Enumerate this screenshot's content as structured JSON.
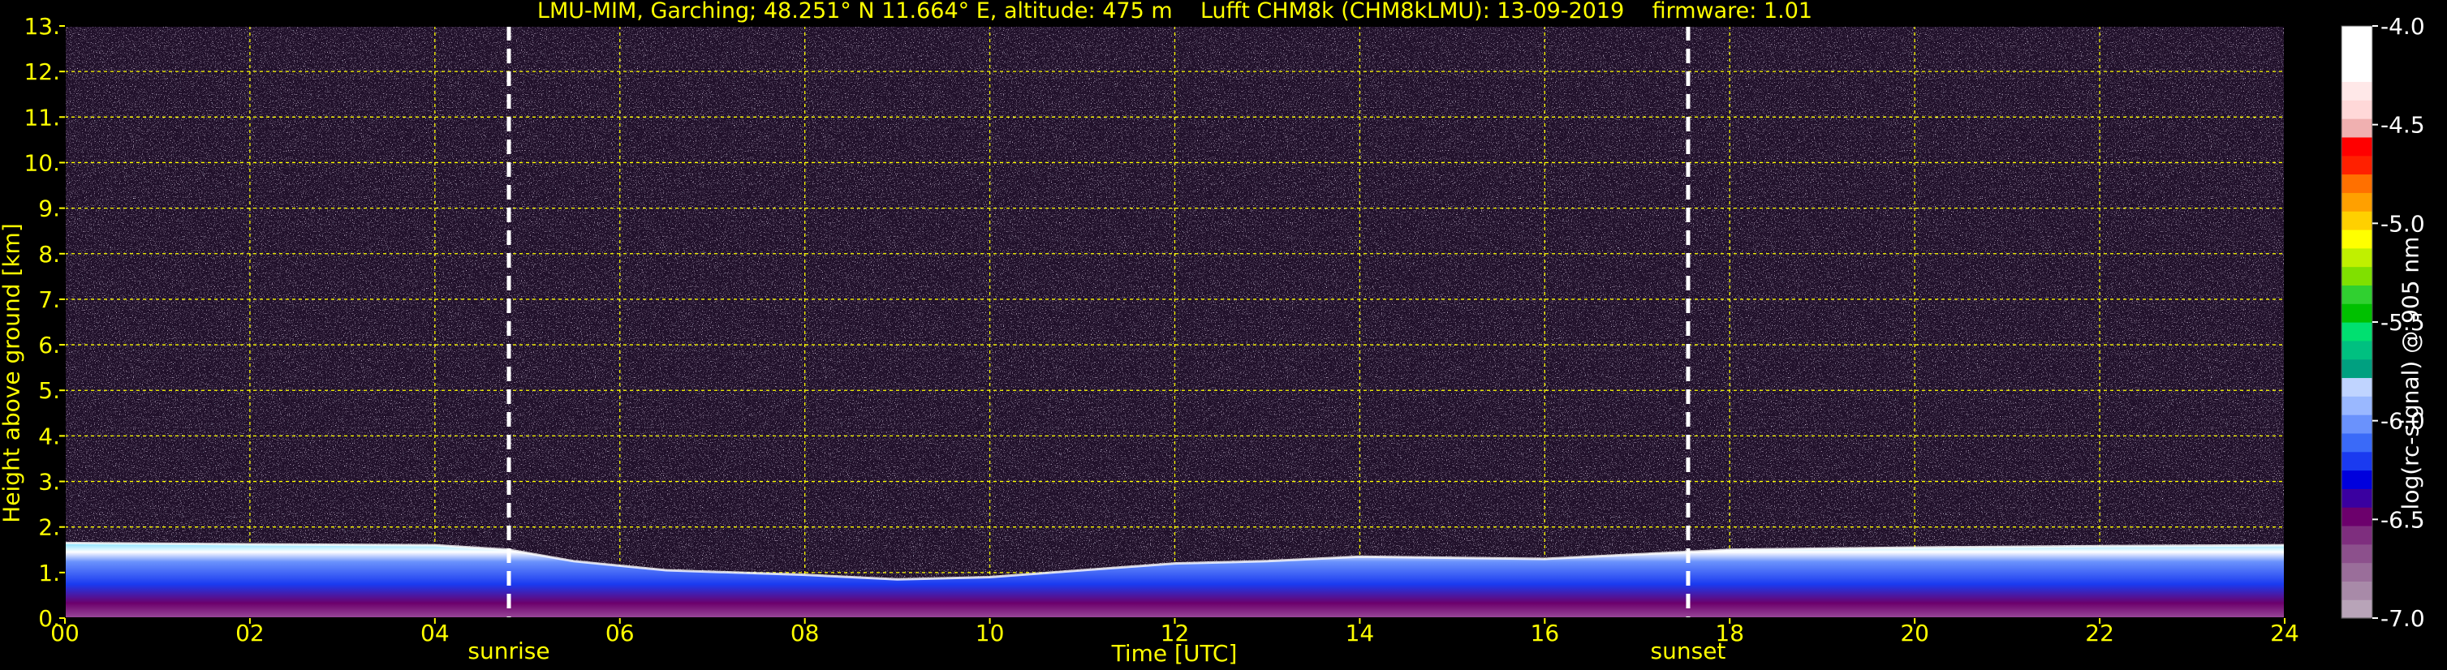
{
  "title": "LMU-MIM, Garching; 48.251° N 11.664° E, altitude: 475 m    Lufft CHM8k (CHM8kLMU): 13-09-2019    firmware: 1.01",
  "colors": {
    "axis_text": "#ffff00",
    "grid": "#ffff00",
    "background": "#000000",
    "cbar_text": "#ffffff"
  },
  "chart_data": {
    "type": "heatmap",
    "title": "LMU-MIM, Garching; 48.251° N 11.664° E, altitude: 475 m    Lufft CHM8k (CHM8kLMU): 13-09-2019    firmware: 1.01",
    "xlabel": "Time [UTC]",
    "ylabel": "Height above ground [km]",
    "xlim": [
      0,
      24
    ],
    "ylim": [
      0,
      13
    ],
    "xticks": [
      0,
      2,
      4,
      6,
      8,
      10,
      12,
      14,
      16,
      18,
      20,
      22,
      24
    ],
    "xtick_labels": [
      "00",
      "02",
      "04",
      "06",
      "08",
      "10",
      "12",
      "14",
      "16",
      "18",
      "20",
      "22",
      "24"
    ],
    "yticks": [
      0,
      1,
      2,
      3,
      4,
      5,
      6,
      7,
      8,
      9,
      10,
      11,
      12,
      13
    ],
    "ytick_labels": [
      "0.",
      "1.",
      "2.",
      "3.",
      "4.",
      "5.",
      "6.",
      "7.",
      "8.",
      "9.",
      "10.",
      "11.",
      "12.",
      "13."
    ],
    "grid": true,
    "annotations": [
      {
        "label": "sunrise",
        "x": 4.8
      },
      {
        "label": "sunset",
        "x": 17.55
      }
    ],
    "boundary_layer_top_km": [
      [
        0,
        1.65
      ],
      [
        2,
        1.62
      ],
      [
        4,
        1.6
      ],
      [
        4.8,
        1.5
      ],
      [
        5.5,
        1.25
      ],
      [
        6.5,
        1.05
      ],
      [
        8,
        0.95
      ],
      [
        9,
        0.85
      ],
      [
        10,
        0.9
      ],
      [
        11,
        1.05
      ],
      [
        12,
        1.2
      ],
      [
        13,
        1.25
      ],
      [
        14,
        1.35
      ],
      [
        16,
        1.3
      ],
      [
        17.5,
        1.45
      ],
      [
        18,
        1.5
      ],
      [
        20,
        1.55
      ],
      [
        22,
        1.58
      ],
      [
        24,
        1.6
      ]
    ],
    "colorbar": {
      "label": "log(rc-signal) @ 905 nm",
      "min": -7.0,
      "max": -4.0,
      "ticks": [
        -7.0,
        -6.5,
        -6.0,
        -5.5,
        -5.0,
        -4.5,
        -4.0
      ],
      "tick_labels": [
        "-7.0",
        "-6.5",
        "-6.0",
        "-5.5",
        "-5.0",
        "-4.5",
        "-4.0"
      ],
      "colors": [
        "#b8a4b8",
        "#a88aa8",
        "#9a6e9a",
        "#8c508c",
        "#7e2e7e",
        "#6c006c",
        "#3a00a0",
        "#0000dd",
        "#1a3af0",
        "#3a6af8",
        "#6a92fc",
        "#9ab8ff",
        "#c0d4ff",
        "#00a080",
        "#00c080",
        "#00e070",
        "#00c000",
        "#30d030",
        "#80e000",
        "#c0f000",
        "#ffff00",
        "#ffd000",
        "#ffa000",
        "#ff7000",
        "#ff2000",
        "#ff0000",
        "#f0b0b0",
        "#ffd8d8",
        "#ffe8e8",
        "#ffffff",
        "#ffffff",
        "#ffffff"
      ]
    }
  }
}
